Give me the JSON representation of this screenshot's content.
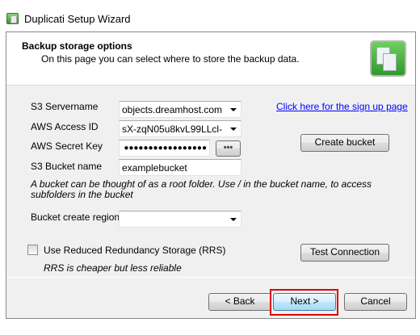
{
  "window": {
    "title": "Duplicati Setup Wizard"
  },
  "header": {
    "title": "Backup storage options",
    "subtitle": "On this page you can select where to store the backup data."
  },
  "form": {
    "servername": {
      "label": "S3 Servername",
      "value": "objects.dreamhost.com"
    },
    "access_id": {
      "label": "AWS Access ID",
      "value": "sX-zqN05u8kvL99LLcl-"
    },
    "secret_key": {
      "label": "AWS Secret Key",
      "value": "●●●●●●●●●●●●●●●●●",
      "reveal_label": "•••"
    },
    "bucket": {
      "label": "S3 Bucket name",
      "value": "examplebucket"
    },
    "bucket_note": "A bucket can be thought of as a root folder. Use / in the bucket name, to access subfolders in the bucket",
    "region": {
      "label": "Bucket create region",
      "value": ""
    },
    "rrs": {
      "label": "Use Reduced Redundancy Storage (RRS)",
      "checked": false,
      "note": "RRS is cheaper but less reliable"
    },
    "signup_link": "Click here for the sign up page",
    "create_bucket": "Create bucket",
    "test_connection": "Test Connection"
  },
  "footer": {
    "back": "< Back",
    "next": "Next >",
    "cancel": "Cancel"
  }
}
